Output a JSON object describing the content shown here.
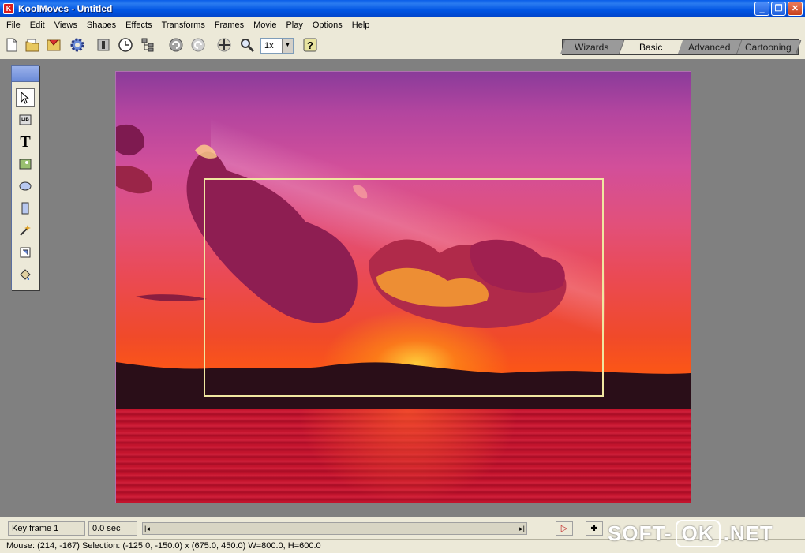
{
  "window": {
    "title": "KoolMoves - Untitled",
    "app_icon_letter": "K"
  },
  "menu": [
    "File",
    "Edit",
    "Views",
    "Shapes",
    "Effects",
    "Transforms",
    "Frames",
    "Movie",
    "Play",
    "Options",
    "Help"
  ],
  "toolbar": {
    "zoom_value": "1x",
    "zoom_dropdown_glyph": "▼",
    "help_glyph": "?"
  },
  "mode_tabs": [
    {
      "label": "Wizards",
      "active": false
    },
    {
      "label": "Basic",
      "active": true
    },
    {
      "label": "Advanced",
      "active": false
    },
    {
      "label": "Cartooning",
      "active": false
    }
  ],
  "palette_tools": [
    "arrow-tool-icon",
    "library-tool-icon",
    "text-tool-icon",
    "image-tool-icon",
    "ellipse-tool-icon",
    "rectangle-tool-icon",
    "magic-wand-tool-icon",
    "crop-tool-icon",
    "paint-bucket-tool-icon"
  ],
  "palette_text_glyph": "T",
  "palette_lib_label": "LIB",
  "timeline": {
    "keyframe_label": "Key frame 1",
    "time_label": "0.0 sec",
    "scroll_left_glyph": "|◂",
    "scroll_right_glyph": "▸|",
    "play_glyph": "▷",
    "add_glyph": "✚"
  },
  "status": {
    "text": "Mouse: (214, -167)  Selection: (-125.0, -150.0) x (675.0, 450.0)  W=800.0,  H=600.0"
  },
  "watermark": {
    "prefix": "SOFT-",
    "boxed": "OK",
    "suffix": ".NET"
  },
  "colors": {
    "titlebar": "#0054e3",
    "chrome": "#ece9d8",
    "workspace": "#808080",
    "selection": "#f0e6a0"
  }
}
